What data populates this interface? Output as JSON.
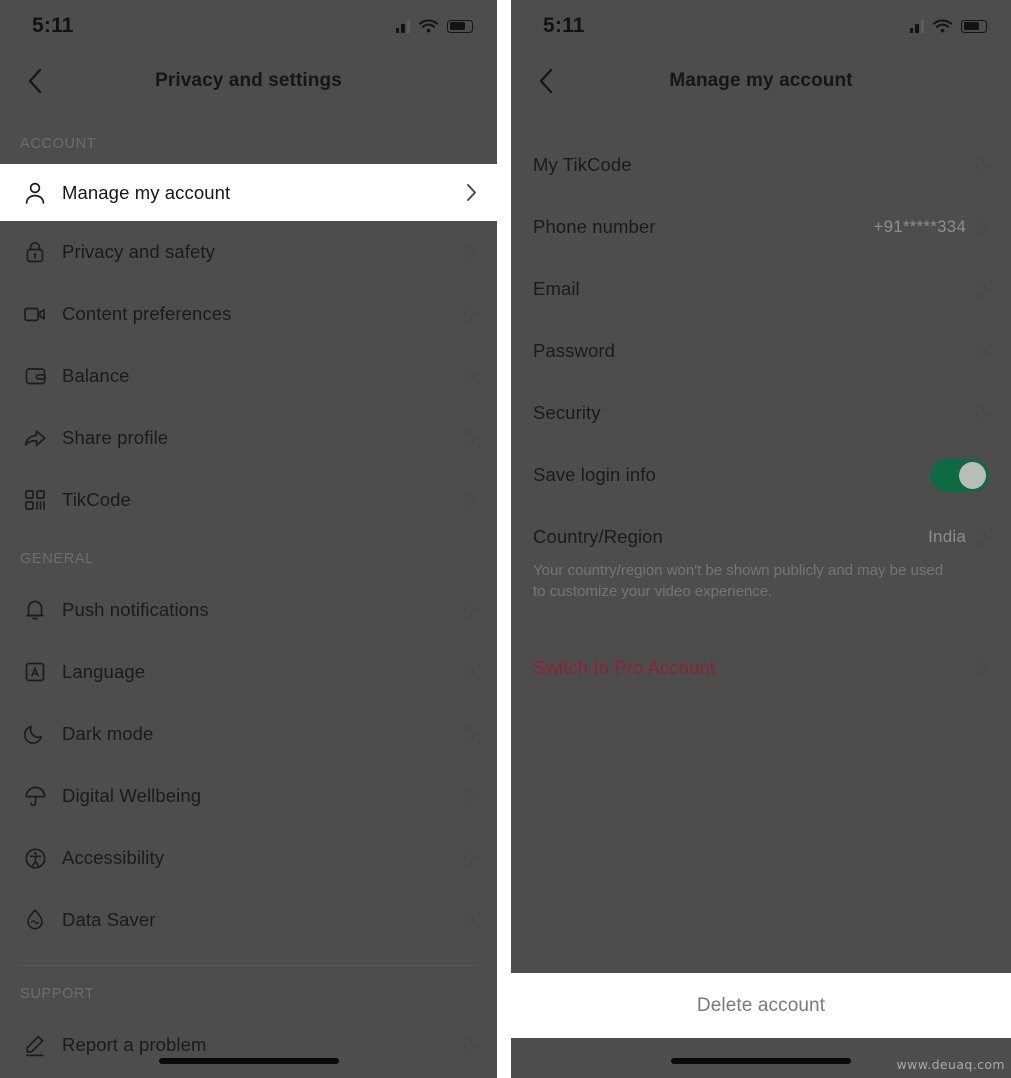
{
  "watermark": "www.deuaq.com",
  "colors": {
    "dim_background": "#4d4d4d",
    "bright_background": "#ffffff",
    "accent_green_toggle": "#0c6b42",
    "accent_red_pro": "#8d2232",
    "text_primary": "#1b1b1b",
    "text_muted": "#8d8d8d"
  },
  "left_panel": {
    "statusbar": {
      "time": "5:11",
      "signal_icon": "cellular-signal-icon",
      "wifi_icon": "wifi-icon",
      "battery_icon": "battery-icon"
    },
    "header": {
      "back_icon": "chevron-left-icon",
      "title": "Privacy and settings"
    },
    "sections": [
      {
        "label": "ACCOUNT",
        "items": [
          {
            "icon": "person-icon",
            "label": "Manage my account",
            "chevron": "chevron-right-icon",
            "highlighted": true
          },
          {
            "icon": "lock-icon",
            "label": "Privacy and safety",
            "chevron": "chevron-right-icon",
            "highlighted": false
          },
          {
            "icon": "video-icon",
            "label": "Content preferences",
            "chevron": "chevron-right-icon",
            "highlighted": false
          },
          {
            "icon": "wallet-icon",
            "label": "Balance",
            "chevron": "chevron-right-icon",
            "highlighted": false
          },
          {
            "icon": "share-icon",
            "label": "Share profile",
            "chevron": "chevron-right-icon",
            "highlighted": false
          },
          {
            "icon": "qrcode-icon",
            "label": "TikCode",
            "chevron": "chevron-right-icon",
            "highlighted": false
          }
        ]
      },
      {
        "label": "GENERAL",
        "items": [
          {
            "icon": "bell-icon",
            "label": "Push notifications",
            "chevron": "chevron-right-icon",
            "highlighted": false
          },
          {
            "icon": "language-icon",
            "label": "Language",
            "chevron": "chevron-right-icon",
            "highlighted": false
          },
          {
            "icon": "moon-icon",
            "label": "Dark mode",
            "chevron": "chevron-right-icon",
            "highlighted": false
          },
          {
            "icon": "umbrella-icon",
            "label": "Digital Wellbeing",
            "chevron": "chevron-right-icon",
            "highlighted": false
          },
          {
            "icon": "accessibility-icon",
            "label": "Accessibility",
            "chevron": "chevron-right-icon",
            "highlighted": false
          },
          {
            "icon": "datasaver-icon",
            "label": "Data Saver",
            "chevron": "chevron-right-icon",
            "highlighted": false
          }
        ]
      },
      {
        "label": "SUPPORT",
        "items": [
          {
            "icon": "pencil-icon",
            "label": "Report a problem",
            "chevron": "chevron-right-icon",
            "highlighted": false
          }
        ]
      }
    ]
  },
  "right_panel": {
    "statusbar": {
      "time": "5:11",
      "signal_icon": "cellular-signal-icon",
      "wifi_icon": "wifi-icon",
      "battery_icon": "battery-icon"
    },
    "header": {
      "back_icon": "chevron-left-icon",
      "title": "Manage my account"
    },
    "items": [
      {
        "label": "My TikCode",
        "value": "",
        "control": "chevron",
        "chevron": "chevron-right-icon"
      },
      {
        "label": "Phone number",
        "value": "+91*****334",
        "control": "chevron",
        "chevron": "chevron-right-icon"
      },
      {
        "label": "Email",
        "value": "",
        "control": "chevron",
        "chevron": "chevron-right-icon"
      },
      {
        "label": "Password",
        "value": "",
        "control": "chevron",
        "chevron": "chevron-right-icon"
      },
      {
        "label": "Security",
        "value": "",
        "control": "chevron",
        "chevron": "chevron-right-icon"
      },
      {
        "label": "Save login info",
        "value": "",
        "control": "toggle",
        "toggle_on": true
      },
      {
        "label": "Country/Region",
        "value": "India",
        "control": "chevron",
        "chevron": "chevron-right-icon"
      }
    ],
    "country_helper": "Your country/region won't be shown publicly and may be used to customize your video experience.",
    "pro_row": {
      "label": "Switch to Pro Account",
      "chevron": "chevron-right-icon"
    },
    "delete_account": {
      "label": "Delete account"
    }
  }
}
